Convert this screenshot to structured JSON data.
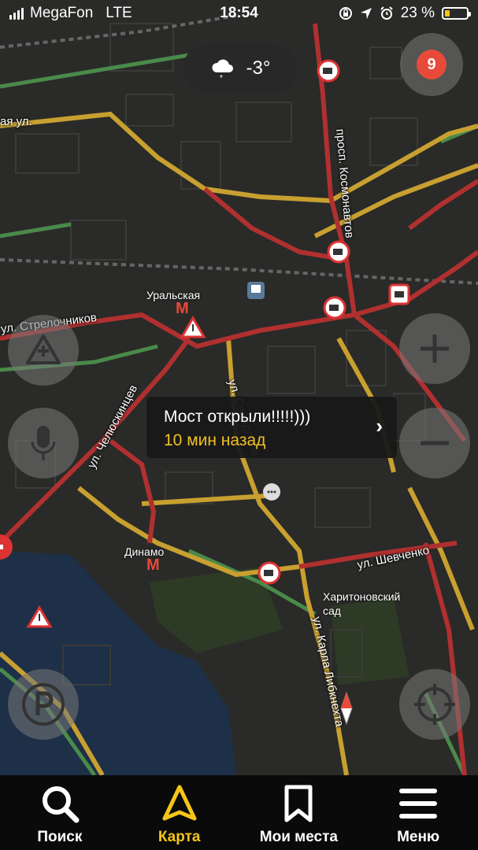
{
  "status_bar": {
    "carrier": "MegaFon",
    "network": "LTE",
    "time": "18:54",
    "battery_percent": "23 %",
    "battery_level": 0.23,
    "icons": [
      "lock-rotation-icon",
      "location-arrow-icon",
      "alarm-icon"
    ]
  },
  "weather": {
    "icon": "snow-cloud-icon",
    "temperature": "-3°"
  },
  "traffic_level": {
    "value": "9",
    "color": "#e84a3a"
  },
  "map": {
    "streets": {
      "kosmonavtov": "просп. Космонавтов",
      "strelochnikov": "ул. Стрелочников",
      "chelyuskintsev": "ул. Челюскинцев",
      "sverdlova": "ул. Свердлова",
      "shevchenko": "ул. Шевченко",
      "karla_libknehta": "ул. Карла Либкнехта",
      "partial_top": "ая ул."
    },
    "places": {
      "uralskaya": "Уральская",
      "dinamo": "Динамо",
      "kharitonovsky": "Харитоновский сад"
    },
    "colors": {
      "jam": "#b03030",
      "slow": "#c8a030",
      "free": "#4a8a4a",
      "water": "#1e3048",
      "park": "#2c3a26"
    }
  },
  "popup": {
    "message": "Мост открыли!!!!!)))",
    "time_ago": "10 мин назад",
    "chevron": "›"
  },
  "tab_bar": {
    "tabs": [
      {
        "label": "Поиск",
        "icon": "search-icon",
        "active": false
      },
      {
        "label": "Карта",
        "icon": "navigation-arrow-icon",
        "active": true
      },
      {
        "label": "Мои места",
        "icon": "bookmark-icon",
        "active": false
      },
      {
        "label": "Меню",
        "icon": "menu-icon",
        "active": false
      }
    ],
    "active_color": "#f5c518"
  }
}
